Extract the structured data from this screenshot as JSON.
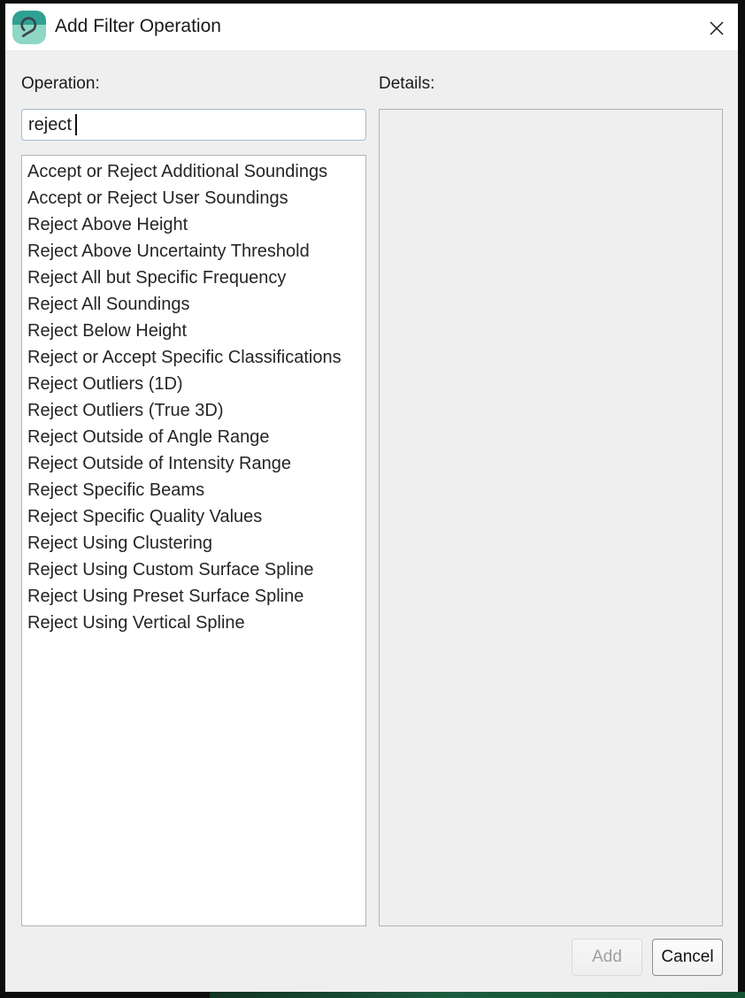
{
  "window": {
    "title": "Add Filter Operation",
    "app_icon": "qimera-swirl-icon",
    "close_icon": "close-x-icon"
  },
  "left_panel": {
    "label": "Operation:",
    "search": {
      "value": "reject",
      "placeholder": ""
    },
    "operations": [
      "Accept or Reject Additional Soundings",
      "Accept or Reject User Soundings",
      "Reject Above Height",
      "Reject Above Uncertainty Threshold",
      "Reject All but Specific Frequency",
      "Reject All Soundings",
      "Reject Below Height",
      "Reject or Accept Specific Classifications",
      "Reject Outliers (1D)",
      "Reject Outliers (True 3D)",
      "Reject Outside of Angle Range",
      "Reject Outside of Intensity Range",
      "Reject Specific Beams",
      "Reject Specific Quality Values",
      "Reject Using Clustering",
      "Reject Using Custom Surface Spline",
      "Reject Using Preset Surface Spline",
      "Reject Using Vertical Spline"
    ]
  },
  "right_panel": {
    "label": "Details:",
    "content": ""
  },
  "buttons": {
    "add": {
      "label": "Add",
      "enabled": false
    },
    "cancel": {
      "label": "Cancel",
      "enabled": true
    }
  },
  "colors": {
    "icon_teal_dark": "#2ea193",
    "icon_teal_light": "#8fd7c5",
    "titlebar_bg": "#ffffff",
    "dialog_bg": "#efefef",
    "panel_border": "#b3b3b3",
    "input_border": "#a3bace",
    "behind_app_green": "#1d5c3e",
    "frame_black": "#0d0d0d"
  }
}
